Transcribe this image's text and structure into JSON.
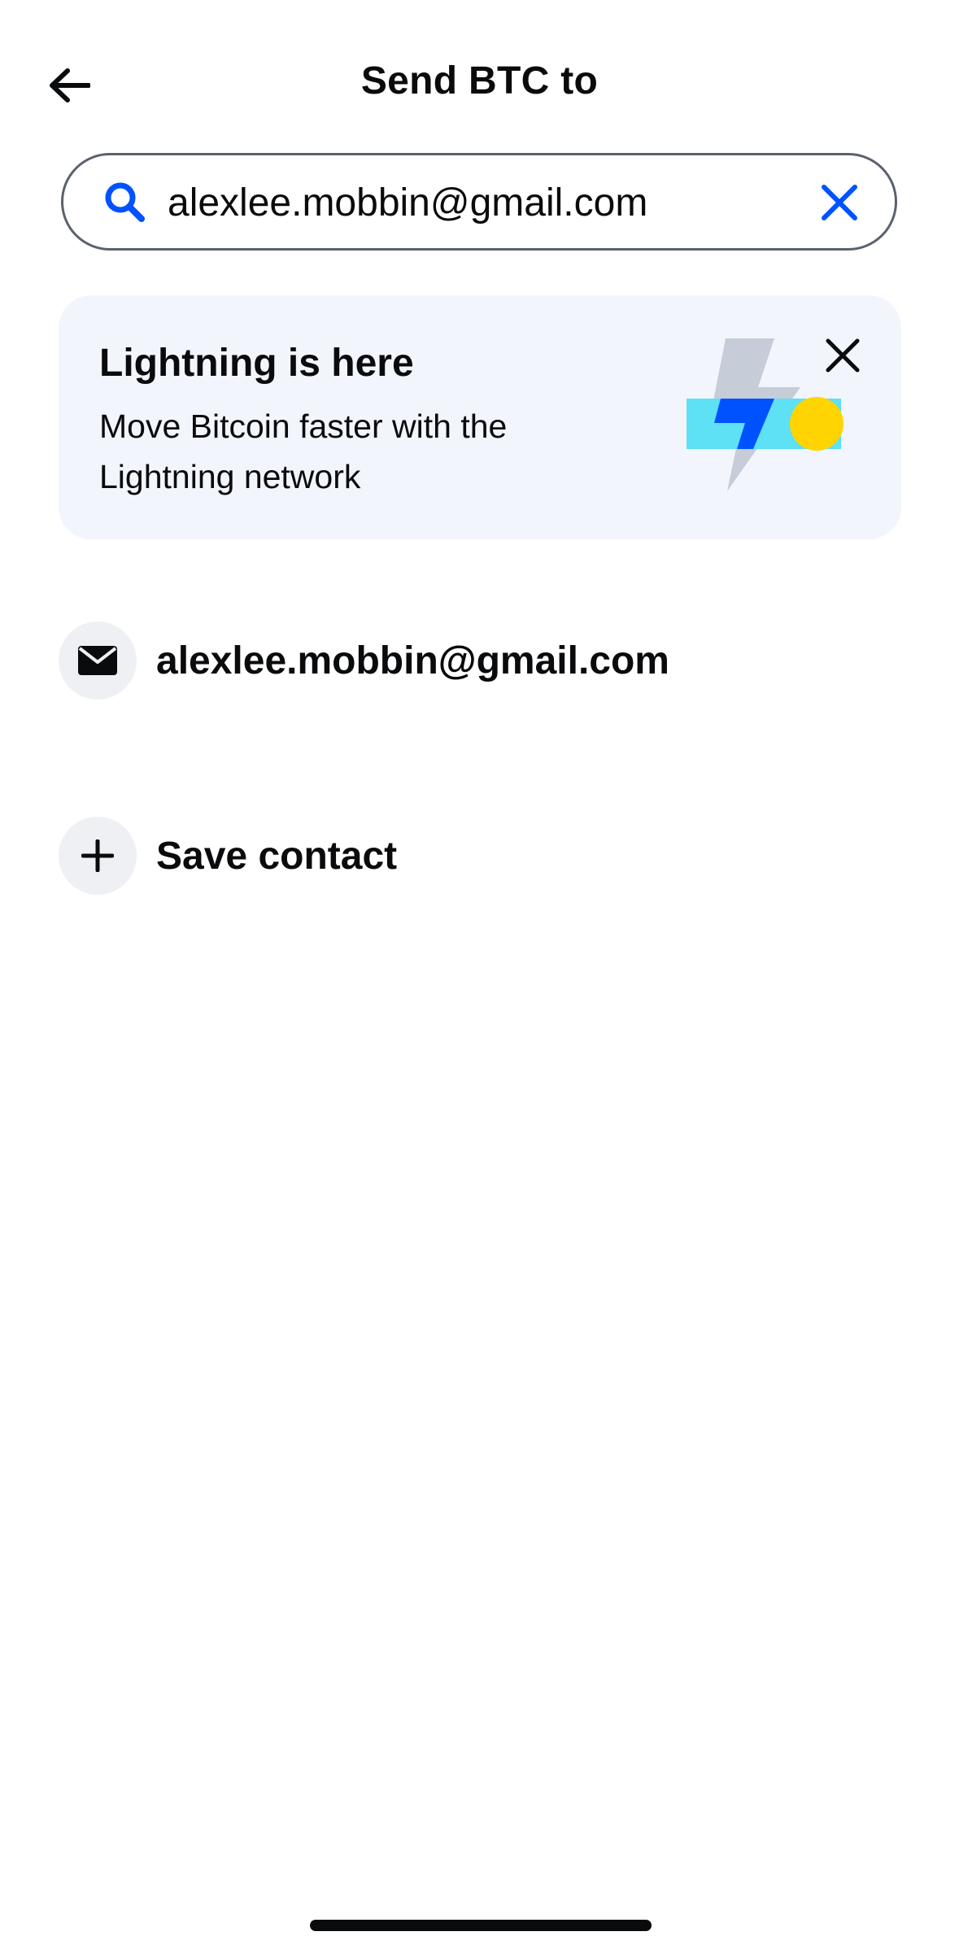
{
  "header": {
    "back_icon": "arrow-left-icon",
    "title": "Send BTC to"
  },
  "search": {
    "icon": "search-icon",
    "value": "alexlee.mobbin@gmail.com",
    "clear_icon": "close-icon"
  },
  "banner": {
    "title": "Lightning is here",
    "text": "Move Bitcoin faster with the Lightning network",
    "art": "lightning-illustration",
    "close_icon": "close-icon"
  },
  "results": [
    {
      "icon": "mail-icon",
      "label": "alexlee.mobbin@gmail.com"
    },
    {
      "icon": "plus-icon",
      "label": "Save contact"
    }
  ],
  "colors": {
    "accent": "#0052ff",
    "banner_bg": "#f2f5fc",
    "icon_circle_bg": "#eef0f3",
    "text": "#0a0b0d",
    "border": "#5b616e"
  }
}
